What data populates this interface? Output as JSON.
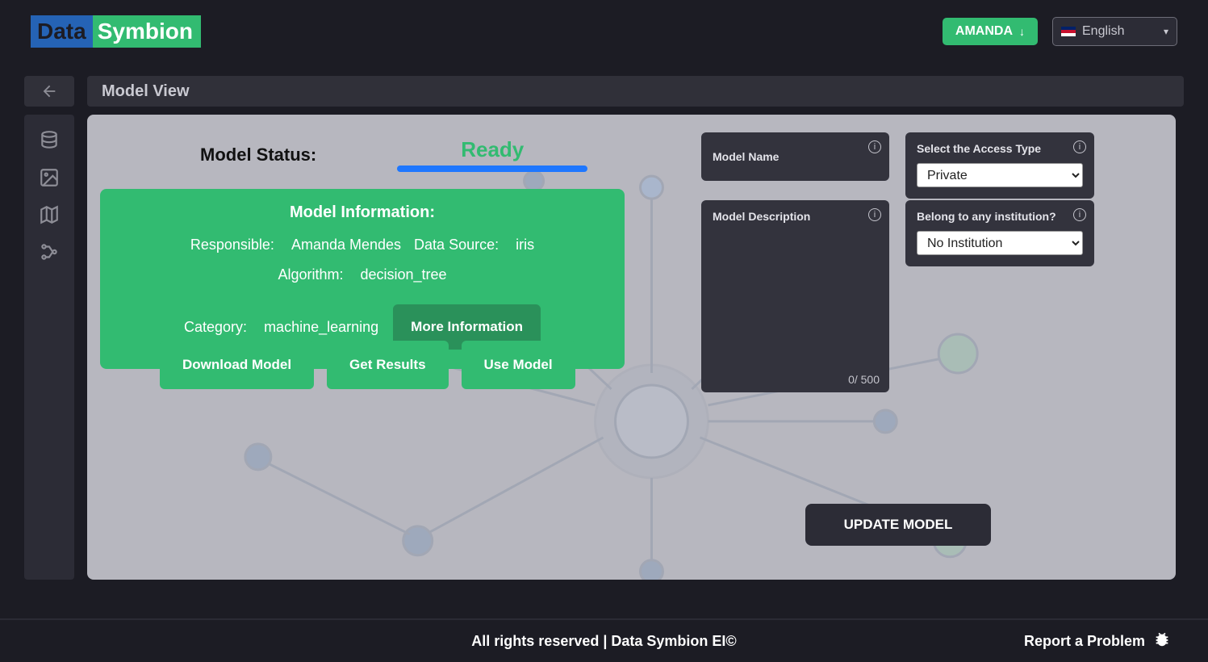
{
  "header": {
    "brand": {
      "part1": "Data",
      "part2": " Symbion"
    },
    "user_label": "AMANDA",
    "language": "English"
  },
  "page": {
    "title": "Model View"
  },
  "sidebar": {
    "items": [
      {
        "name": "database-icon"
      },
      {
        "name": "image-icon"
      },
      {
        "name": "map-icon"
      },
      {
        "name": "neural-icon"
      }
    ]
  },
  "status": {
    "label": "Model Status:",
    "value": "Ready"
  },
  "info_card": {
    "title": "Model Information:",
    "responsible_label": "Responsible:",
    "responsible_value": "Amanda Mendes",
    "datasource_label": "Data Source:",
    "datasource_value": "iris",
    "algorithm_label": "Algorithm:",
    "algorithm_value": "decision_tree",
    "category_label": "Category:",
    "category_value": "machine_learning",
    "more_button": "More Information"
  },
  "actions": {
    "download": "Download Model",
    "results": "Get Results",
    "use": "Use Model"
  },
  "form": {
    "name_label": "Model Name",
    "name_value": "",
    "access_label": "Select the Access Type",
    "access_value": "Private",
    "desc_label": "Model Description",
    "desc_value": "",
    "desc_count": "0",
    "desc_sep": "/ ",
    "desc_max": "500",
    "inst_label": "Belong to any institution?",
    "inst_value": "No Institution",
    "update_button": "UPDATE MODEL"
  },
  "footer": {
    "copy": "All rights reserved | Data Symbion EI©",
    "report": "Report a Problem"
  }
}
